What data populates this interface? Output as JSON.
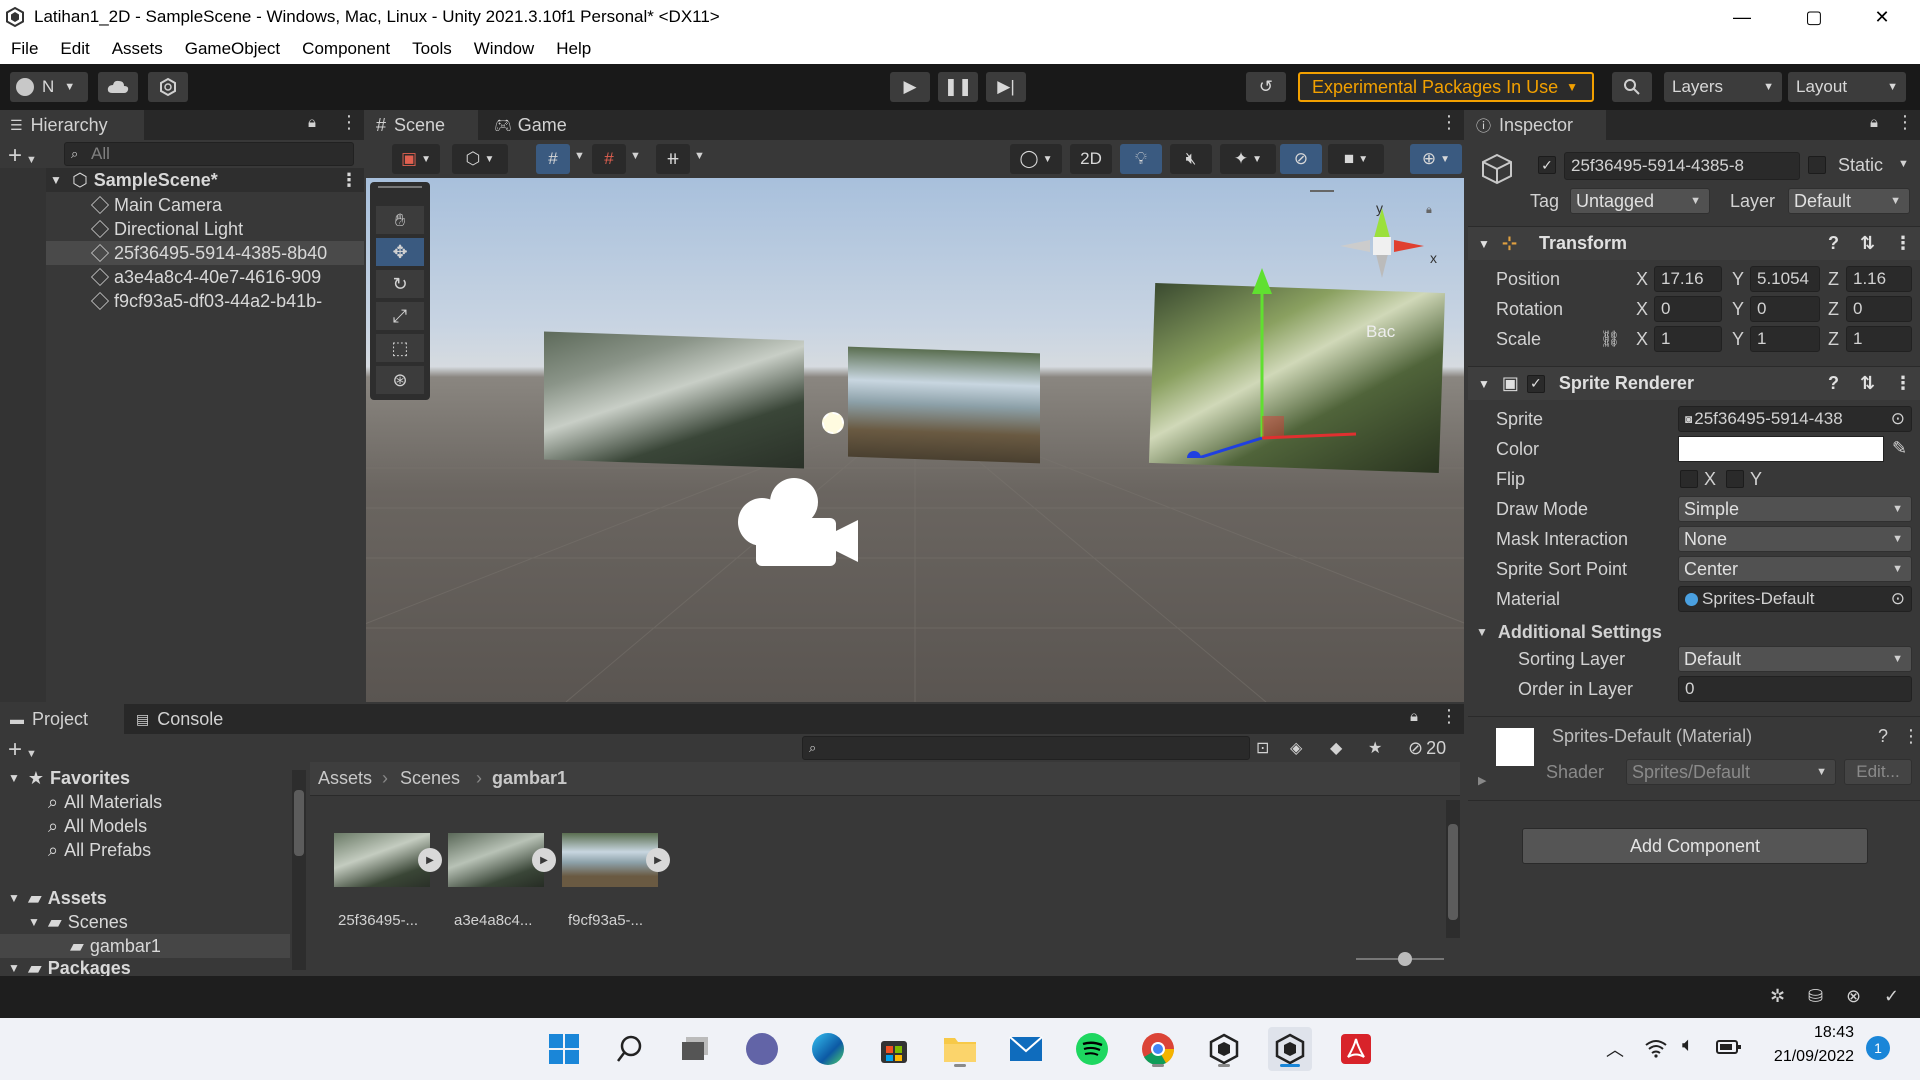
{
  "window": {
    "title": "Latihan1_2D - SampleScene - Windows, Mac, Linux - Unity 2021.3.10f1 Personal* <DX11>",
    "controls": [
      "—",
      "▢",
      "✕"
    ]
  },
  "menu": [
    "File",
    "Edit",
    "Assets",
    "GameObject",
    "Component",
    "Tools",
    "Window",
    "Help"
  ],
  "toolbar": {
    "account_label": "N",
    "experimental_label": "Experimental Packages In Use",
    "layers_label": "Layers",
    "layout_label": "Layout"
  },
  "hierarchy": {
    "tab": "Hierarchy",
    "search_placeholder": "All",
    "scene": "SampleScene*",
    "items": [
      "Main Camera",
      "Directional Light",
      "25f36495-5914-4385-8b40",
      "a3e4a8c4-40e7-4616-909",
      "f9cf93a5-df03-44a2-b41b-"
    ],
    "selected_index": 2
  },
  "scene_tabs": [
    "Scene",
    "Game"
  ],
  "scene_toolbar": {
    "two_d_label": "2D"
  },
  "gizmo": {
    "y": "y",
    "x": "x",
    "back": "Bac"
  },
  "project": {
    "tabs": [
      "Project",
      "Console"
    ],
    "favorites_label": "Favorites",
    "favorites": [
      "All Materials",
      "All Models",
      "All Prefabs"
    ],
    "assets_label": "Assets",
    "scenes_label": "Scenes",
    "gambar1_label": "gambar1",
    "packages_label": "Packages",
    "breadcrumb": [
      "Assets",
      "Scenes",
      "gambar1"
    ],
    "hidden_count": "20",
    "assets": [
      "25f36495-...",
      "a3e4a8c4...",
      "f9cf93a5-..."
    ]
  },
  "inspector": {
    "tab": "Inspector",
    "object_name": "25f36495-5914-4385-8",
    "static_label": "Static",
    "tag_label": "Tag",
    "tag_value": "Untagged",
    "layer_label": "Layer",
    "layer_value": "Default",
    "transform": {
      "title": "Transform",
      "position_label": "Position",
      "rotation_label": "Rotation",
      "scale_label": "Scale",
      "position": [
        "17.16",
        "5.1054",
        "1.16"
      ],
      "rotation": [
        "0",
        "0",
        "0"
      ],
      "scale": [
        "1",
        "1",
        "1"
      ],
      "axes": [
        "X",
        "Y",
        "Z"
      ]
    },
    "sprite_renderer": {
      "title": "Sprite Renderer",
      "sprite_label": "Sprite",
      "sprite_value": "25f36495-5914-438",
      "color_label": "Color",
      "flip_label": "Flip",
      "flip_x": "X",
      "flip_y": "Y",
      "draw_mode_label": "Draw Mode",
      "draw_mode_value": "Simple",
      "mask_label": "Mask Interaction",
      "mask_value": "None",
      "sort_point_label": "Sprite Sort Point",
      "sort_point_value": "Center",
      "material_label": "Material",
      "material_value": "Sprites-Default",
      "additional_label": "Additional Settings",
      "sorting_layer_label": "Sorting Layer",
      "sorting_layer_value": "Default",
      "order_label": "Order in Layer",
      "order_value": "0"
    },
    "material": {
      "title": "Sprites-Default (Material)",
      "shader_label": "Shader",
      "shader_value": "Sprites/Default",
      "edit_label": "Edit..."
    },
    "add_component": "Add Component"
  },
  "taskbar": {
    "time": "18:43",
    "date": "21/09/2022",
    "notifications": "1"
  }
}
